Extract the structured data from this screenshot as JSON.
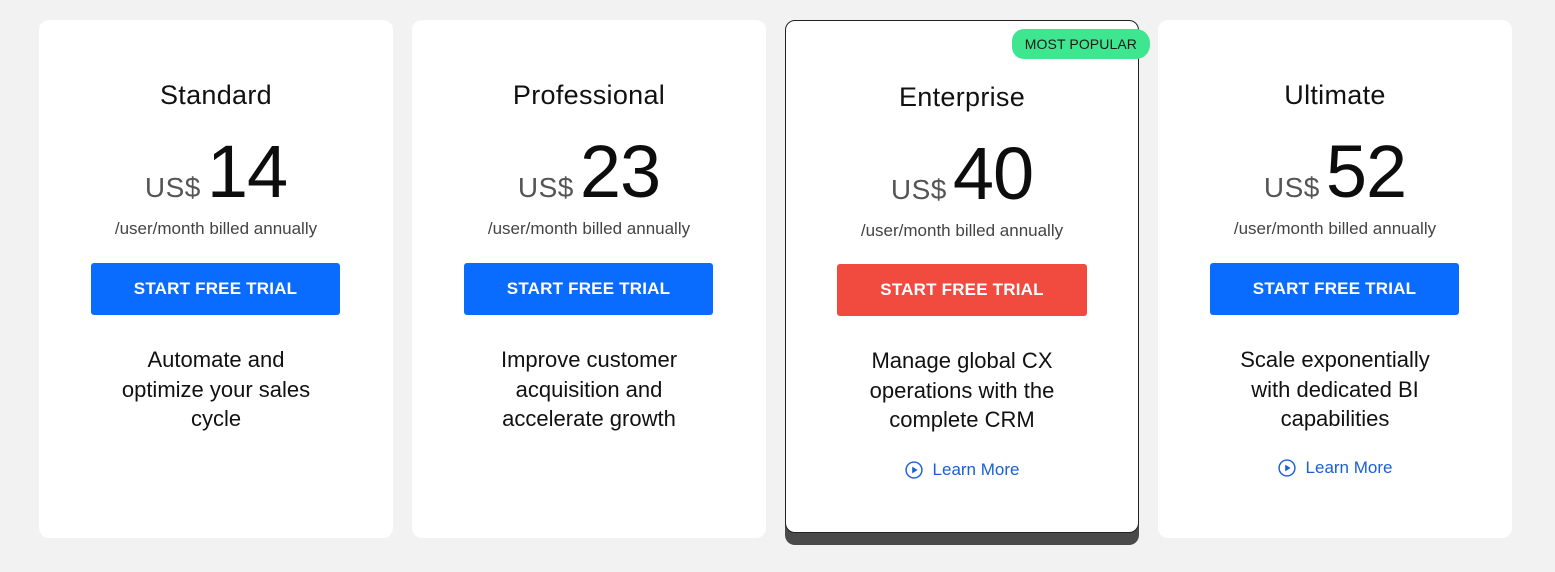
{
  "plans": [
    {
      "name": "Standard",
      "currency": "US$",
      "price": "14",
      "billing": "/user/month billed annually",
      "button": "START FREE TRIAL",
      "description": [
        "Automate and",
        "optimize your sales",
        "cycle"
      ]
    },
    {
      "name": "Professional",
      "currency": "US$",
      "price": "23",
      "billing": "/user/month billed annually",
      "button": "START FREE TRIAL",
      "description": [
        "Improve customer",
        "acquisition and",
        "accelerate growth"
      ]
    },
    {
      "name": "Enterprise",
      "badge": "MOST POPULAR",
      "currency": "US$",
      "price": "40",
      "billing": "/user/month billed annually",
      "button": "START FREE TRIAL",
      "description": [
        "Manage global CX",
        "operations with the",
        "complete CRM"
      ],
      "learn_more": "Learn More"
    },
    {
      "name": "Ultimate",
      "currency": "US$",
      "price": "52",
      "billing": "/user/month billed annually",
      "button": "START FREE TRIAL",
      "description": [
        "Scale exponentially",
        "with dedicated BI",
        "capabilities"
      ],
      "learn_more": "Learn More"
    }
  ],
  "colors": {
    "primary_button": "#0a6cff",
    "highlight_button": "#f14a3f",
    "badge": "#3ee68f",
    "link": "#1a5fd6"
  },
  "icons": {
    "learn_more": "play-circle-icon"
  }
}
